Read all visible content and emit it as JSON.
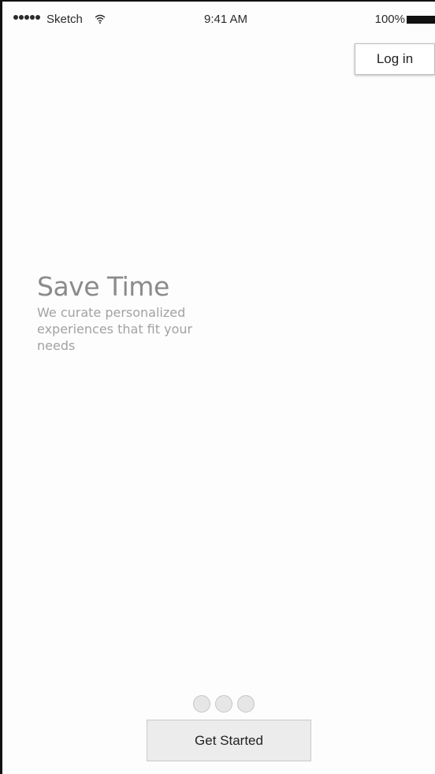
{
  "status_bar": {
    "carrier": "Sketch",
    "wifi_icon": "wifi-icon",
    "time": "9:41 AM",
    "battery": "100%"
  },
  "header": {
    "login_label": "Log in"
  },
  "hero": {
    "title": "Save Time",
    "description": "We curate personalized experiences that fit your needs"
  },
  "pager": {
    "count": 3
  },
  "footer": {
    "cta_label": "Get Started"
  }
}
